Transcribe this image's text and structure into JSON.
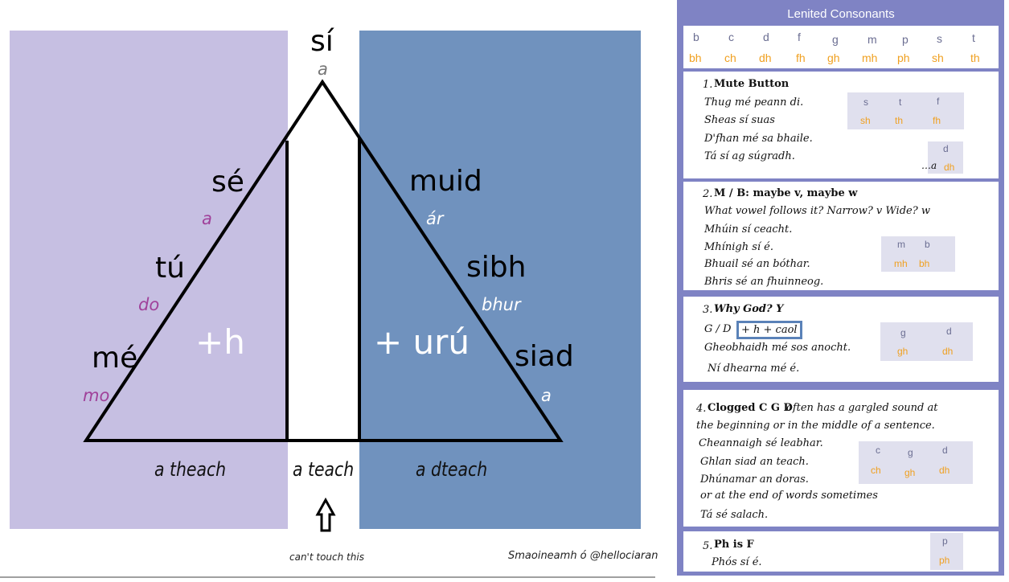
{
  "diagram": {
    "top_pronoun": "sí",
    "top_possessive": "a",
    "left_pronouns": [
      {
        "pron": "sé",
        "poss": "a"
      },
      {
        "pron": "tú",
        "poss": "do"
      },
      {
        "pron": "mé",
        "poss": "mo"
      }
    ],
    "right_pronouns": [
      {
        "pron": "muid",
        "poss": "ár"
      },
      {
        "pron": "sibh",
        "poss": "bhur"
      },
      {
        "pron": "siad",
        "poss": "a"
      }
    ],
    "left_mutation": "+h",
    "right_mutation": "+ urú",
    "house_left": "a theach",
    "house_middle": "a teach",
    "house_right": "a dteach",
    "arrow_caption": "can't touch this",
    "credit": "Smaoineamh ó @hellociaran",
    "colors": {
      "lenition_region": "#c6bfe2",
      "eclipsis_region": "#7092be",
      "left_possessives": "#a0419a"
    }
  },
  "panel": {
    "title": "Lenited Consonants",
    "base": [
      "b",
      "c",
      "d",
      "f",
      "g",
      "m",
      "p",
      "s",
      "t"
    ],
    "lenited": [
      "bh",
      "ch",
      "dh",
      "fh",
      "gh",
      "mh",
      "ph",
      "sh",
      "th"
    ],
    "sections": {
      "s1": {
        "num": "1.",
        "title": "Mute Button",
        "lines": [
          "Thug mé peann di.",
          "Sheas sí suas",
          "D'fhan mé sa bhaile.",
          "Tá sí ag súgradh."
        ],
        "letters": [
          "s",
          "t",
          "f"
        ],
        "lenited": [
          "sh",
          "th",
          "fh"
        ],
        "extra_letter": "d",
        "extra_prefix": "…a",
        "extra_lenited": "dh"
      },
      "s2": {
        "num": "2.",
        "title": "M / B: maybe v, maybe w",
        "lines": [
          "What vowel follows it? Narrow? v Wide? w",
          "Mhúin sí ceacht.",
          "Mhínigh sí é.",
          "Bhuail sé an bóthar.",
          "Bhris sé an fhuinneog."
        ],
        "letters": [
          "m",
          "b"
        ],
        "lenited": [
          "mh",
          "bh"
        ]
      },
      "s3": {
        "num": "3.",
        "title": "Why God? Y",
        "prefix": "G / D",
        "boxed": "+ h + caol",
        "lines": [
          "Gheobhaidh mé sos anocht.",
          "Ní dhearna mé é."
        ],
        "letters": [
          "g",
          "d"
        ],
        "lenited": [
          "gh",
          "dh"
        ]
      },
      "s4": {
        "num": "4.",
        "title": "Clogged C G D",
        "title_tail": "often has a gargled sound at",
        "lines": [
          "the beginning or in the middle of a sentence.",
          "Cheannaigh sé leabhar.",
          "Ghlan siad an teach.",
          "Dhúnamar an doras.",
          "or at the end of words sometimes",
          "Tá sé salach."
        ],
        "letters": [
          "c",
          "g",
          "d"
        ],
        "lenited": [
          "ch",
          "gh",
          "dh"
        ]
      },
      "s5": {
        "num": "5.",
        "title": "Ph is F",
        "lines": [
          "Phós sí é."
        ],
        "letters": [
          "p"
        ],
        "lenited": [
          "ph"
        ]
      }
    }
  }
}
